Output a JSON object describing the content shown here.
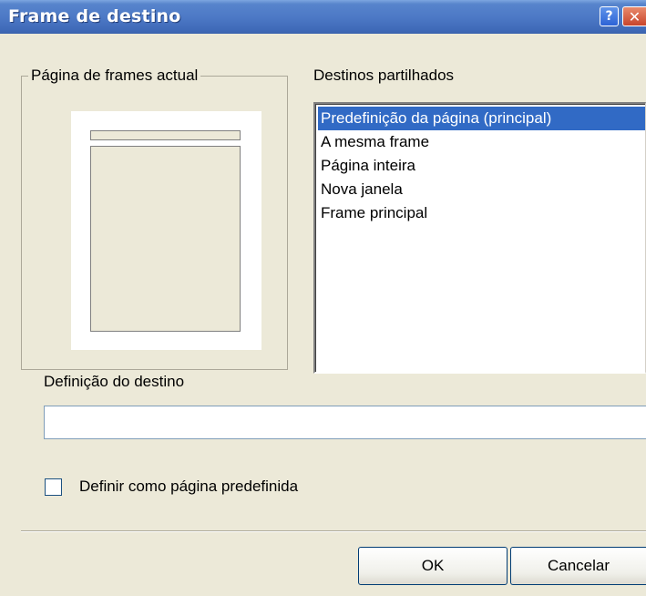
{
  "window": {
    "title": "Frame de destino",
    "help_button": "?",
    "close_button": "✕"
  },
  "current_frames": {
    "legend": "Página de frames actual"
  },
  "shared_targets": {
    "label": "Destinos partilhados",
    "items": [
      {
        "label": "Predefinição da página (principal)",
        "selected": true
      },
      {
        "label": "A mesma frame",
        "selected": false
      },
      {
        "label": "Página inteira",
        "selected": false
      },
      {
        "label": "Nova janela",
        "selected": false
      },
      {
        "label": "Frame principal",
        "selected": false
      }
    ]
  },
  "target_setting": {
    "label": "Definição do destino",
    "value": ""
  },
  "default_checkbox": {
    "label": "Definir como página predefinida",
    "checked": false
  },
  "buttons": {
    "ok": "OK",
    "cancel": "Cancelar"
  },
  "colors": {
    "dialog_bg": "#ece9d8",
    "titlebar": "#4d79c6",
    "selection": "#316ac5"
  }
}
